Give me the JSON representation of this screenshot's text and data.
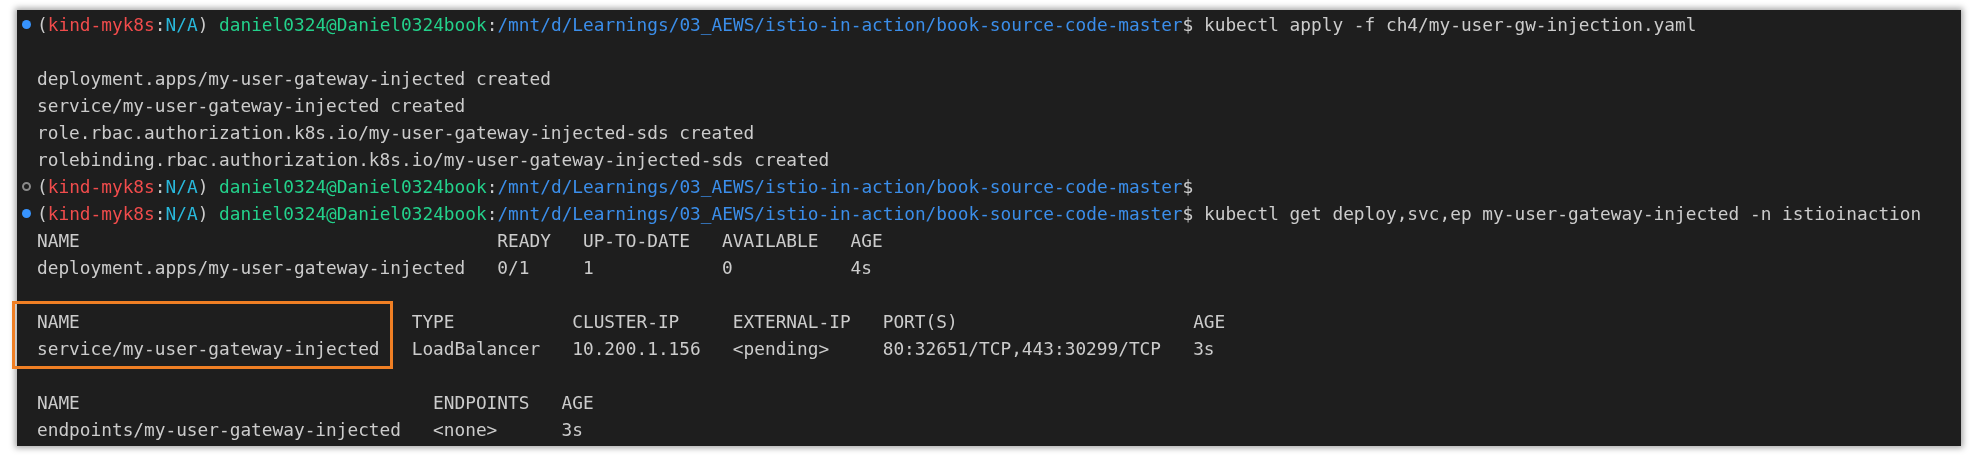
{
  "terminal": {
    "lines": [
      {
        "kind": "prompt",
        "success": true,
        "segments": [
          {
            "kind": "punct",
            "text": "("
          },
          {
            "kind": "context",
            "text": "kind-myk8s"
          },
          {
            "kind": "punct",
            "text": ":"
          },
          {
            "kind": "namespace",
            "text": "N/A"
          },
          {
            "kind": "punct",
            "text": ")"
          },
          {
            "kind": "user",
            "text": "daniel0324@Daniel0324book"
          },
          {
            "kind": "punct",
            "text": ":"
          },
          {
            "kind": "path",
            "text": "/mnt/d/Learnings/03_AEWS/istio-in-action/book-source-code-master"
          },
          {
            "kind": "punct",
            "text": "$"
          },
          {
            "kind": "command",
            "text": "kubectl apply -f ch4/my-user-gw-injection.yaml"
          }
        ]
      },
      {
        "kind": "blank"
      },
      {
        "kind": "output",
        "text": "deployment.apps/my-user-gateway-injected created"
      },
      {
        "kind": "output",
        "text": "service/my-user-gateway-injected created"
      },
      {
        "kind": "output",
        "text": "role.rbac.authorization.k8s.io/my-user-gateway-injected-sds created"
      },
      {
        "kind": "output",
        "text": "rolebinding.rbac.authorization.k8s.io/my-user-gateway-injected-sds created"
      },
      {
        "kind": "prompt",
        "success": false,
        "segments": [
          {
            "kind": "punct",
            "text": "("
          },
          {
            "kind": "context",
            "text": "kind-myk8s"
          },
          {
            "kind": "punct",
            "text": ":"
          },
          {
            "kind": "namespace",
            "text": "N/A"
          },
          {
            "kind": "punct",
            "text": ")"
          },
          {
            "kind": "user",
            "text": "daniel0324@Daniel0324book"
          },
          {
            "kind": "punct",
            "text": ":"
          },
          {
            "kind": "path",
            "text": "/mnt/d/Learnings/03_AEWS/istio-in-action/book-source-code-master"
          },
          {
            "kind": "punct",
            "text": "$"
          }
        ]
      },
      {
        "kind": "prompt",
        "success": true,
        "segments": [
          {
            "kind": "punct",
            "text": "("
          },
          {
            "kind": "context",
            "text": "kind-myk8s"
          },
          {
            "kind": "punct",
            "text": ":"
          },
          {
            "kind": "namespace",
            "text": "N/A"
          },
          {
            "kind": "punct",
            "text": ")"
          },
          {
            "kind": "user",
            "text": "daniel0324@Daniel0324book"
          },
          {
            "kind": "punct",
            "text": ":"
          },
          {
            "kind": "path",
            "text": "/mnt/d/Learnings/03_AEWS/istio-in-action/book-source-code-master"
          },
          {
            "kind": "punct",
            "text": "$"
          },
          {
            "kind": "command",
            "text": "kubectl get deploy,svc,ep my-user-gateway-injected -n istioinaction"
          }
        ]
      },
      {
        "kind": "table",
        "columns": [
          {
            "label": "NAME",
            "highlighted": false
          },
          {
            "label": "READY",
            "highlighted": false
          },
          {
            "label": "UP-TO-DATE",
            "highlighted": false
          },
          {
            "label": "AVAILABLE",
            "highlighted": false
          },
          {
            "label": "AGE",
            "highlighted": false
          }
        ],
        "rows": [
          [
            "deployment.apps/my-user-gateway-injected",
            "0/1",
            "1",
            "0",
            "4s"
          ]
        ]
      },
      {
        "kind": "blank"
      },
      {
        "kind": "table",
        "columns": [
          {
            "label": "NAME",
            "highlighted": true
          },
          {
            "label": "TYPE",
            "highlighted": false
          },
          {
            "label": "CLUSTER-IP",
            "highlighted": false
          },
          {
            "label": "EXTERNAL-IP",
            "highlighted": false
          },
          {
            "label": "PORT(S)",
            "highlighted": false
          },
          {
            "label": "AGE",
            "highlighted": false
          }
        ],
        "rows": [
          [
            "service/my-user-gateway-injected",
            "LoadBalancer",
            "10.200.1.156",
            "<pending>",
            "80:32651/TCP,443:30299/TCP",
            "3s"
          ]
        ]
      },
      {
        "kind": "blank"
      },
      {
        "kind": "table",
        "columns": [
          {
            "label": "NAME",
            "highlighted": false
          },
          {
            "label": "ENDPOINTS",
            "highlighted": false
          },
          {
            "label": "AGE",
            "highlighted": false
          }
        ],
        "rows": [
          [
            "endpoints/my-user-gateway-injected",
            "<none>",
            "3s"
          ]
        ]
      }
    ]
  }
}
